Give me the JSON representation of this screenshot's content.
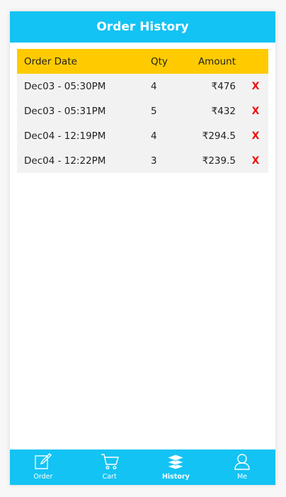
{
  "header": {
    "title": "Order History"
  },
  "table": {
    "columns": {
      "date": "Order Date",
      "qty": "Qty",
      "amount": "Amount"
    },
    "rows": [
      {
        "date": "Dec03 - 05:30PM",
        "qty": "4",
        "amount": "₹476",
        "delete": "X"
      },
      {
        "date": "Dec03 - 05:31PM",
        "qty": "5",
        "amount": "₹432",
        "delete": "X"
      },
      {
        "date": "Dec04 - 12:19PM",
        "qty": "4",
        "amount": "₹294.5",
        "delete": "X"
      },
      {
        "date": "Dec04 - 12:22PM",
        "qty": "3",
        "amount": "₹239.5",
        "delete": "X"
      }
    ]
  },
  "nav": {
    "items": [
      {
        "label": "Order",
        "icon": "edit-icon"
      },
      {
        "label": "Cart",
        "icon": "cart-icon"
      },
      {
        "label": "History",
        "icon": "layers-icon",
        "active": true
      },
      {
        "label": "Me",
        "icon": "user-icon"
      }
    ]
  },
  "colors": {
    "primary": "#13c3f3",
    "table_header": "#ffcb00",
    "row_bg": "#f2f2f2",
    "delete": "#ee1111"
  }
}
